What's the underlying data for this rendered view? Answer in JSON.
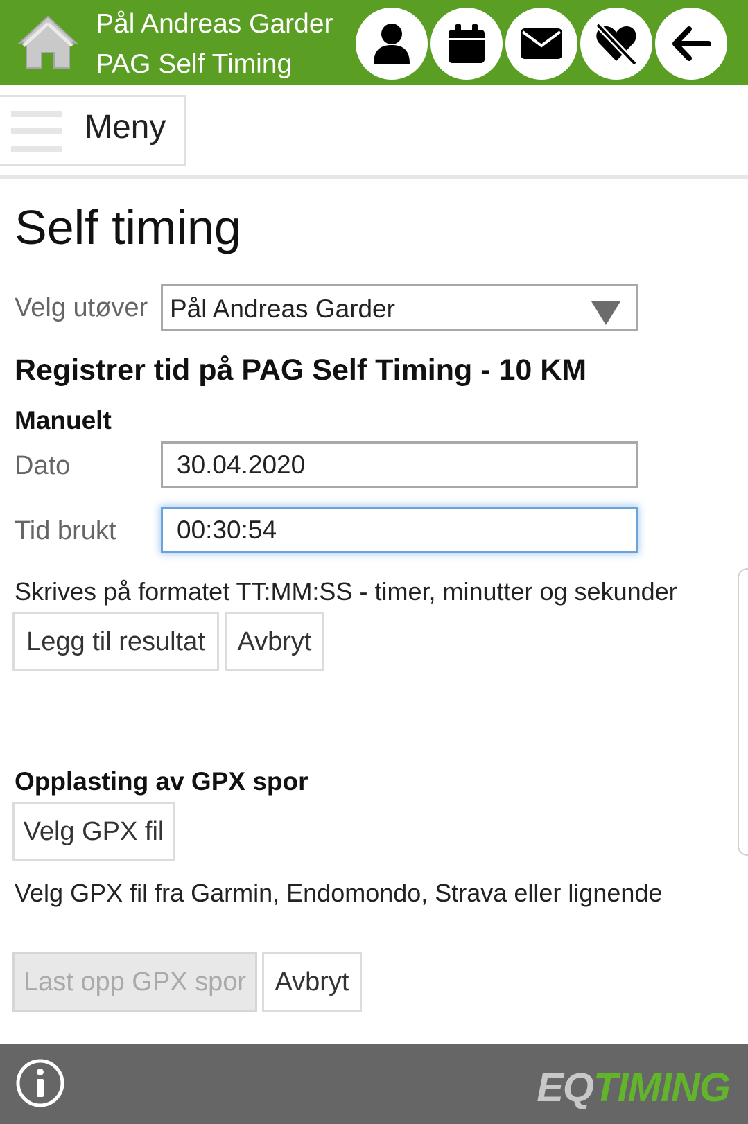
{
  "header": {
    "name": "Pål Andreas Garder",
    "subtitle": "PAG Self Timing",
    "icons": [
      "user-icon",
      "calendar-icon",
      "envelope-icon",
      "no-heart-icon",
      "back-arrow-icon"
    ]
  },
  "menu": {
    "label": "Meny"
  },
  "page": {
    "title": "Self timing",
    "athlete_label": "Velg utøver",
    "athlete_value": "Pål Andreas Garder",
    "register_title": "Registrer tid på PAG Self Timing - 10 KM",
    "manual": {
      "heading": "Manuelt",
      "date_label": "Dato",
      "date_value": "30.04.2020",
      "time_label": "Tid brukt",
      "time_value": "00:30:54",
      "format_help": "Skrives på formatet TT:MM:SS - timer, minutter og sekunder",
      "add_button": "Legg til resultat",
      "cancel_button": "Avbryt"
    },
    "gpx": {
      "heading": "Opplasting av GPX spor",
      "choose_button": "Velg GPX fil",
      "help": "Velg GPX fil fra Garmin, Endomondo, Strava eller lignende",
      "upload_button": "Last opp GPX spor",
      "cancel_button": "Avbryt"
    }
  },
  "footer": {
    "brand_eq": "EQ",
    "brand_timing": "TIMING"
  },
  "colors": {
    "header": "#5a9f24",
    "footer": "#666666",
    "brand_green": "#62b52a"
  }
}
